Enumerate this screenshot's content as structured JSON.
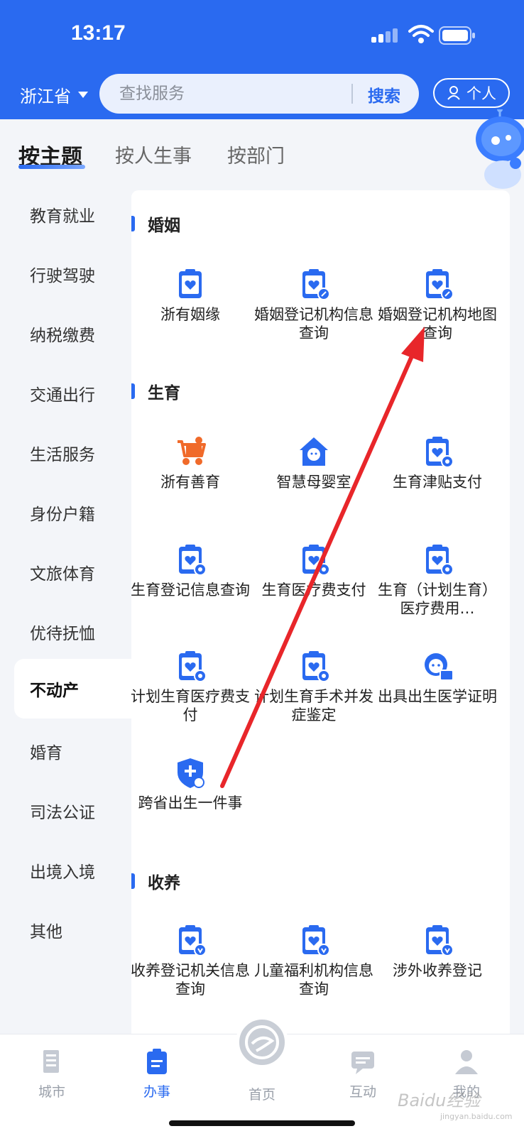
{
  "status": {
    "time": "13:17"
  },
  "header": {
    "province": "浙江省",
    "search_placeholder": "查找服务",
    "search_button": "搜索",
    "personal": "个人"
  },
  "tabs": [
    {
      "label": "按主题",
      "active": true
    },
    {
      "label": "按人生事",
      "active": false
    },
    {
      "label": "按部门",
      "active": false
    }
  ],
  "sidebar": {
    "items": [
      {
        "label": "教育就业"
      },
      {
        "label": "行驶驾驶"
      },
      {
        "label": "纳税缴费"
      },
      {
        "label": "交通出行"
      },
      {
        "label": "生活服务"
      },
      {
        "label": "身份户籍"
      },
      {
        "label": "文旅体育"
      },
      {
        "label": "优待抚恤"
      },
      {
        "label": "不动产",
        "active": true
      },
      {
        "label": "婚育"
      },
      {
        "label": "司法公证"
      },
      {
        "label": "出境入境"
      },
      {
        "label": "其他"
      }
    ]
  },
  "sections": [
    {
      "title": "婚姻",
      "services": [
        {
          "label": "浙有姻缘",
          "icon": "clipboard-heart-icon"
        },
        {
          "label": "婚姻登记机构信息查询",
          "icon": "clipboard-heart-edit-icon"
        },
        {
          "label": "婚姻登记机构地图查询",
          "icon": "clipboard-heart-edit-icon"
        }
      ]
    },
    {
      "title": "生育",
      "services": [
        {
          "label": "浙有善育",
          "icon": "stroller-icon"
        },
        {
          "label": "智慧母婴室",
          "icon": "house-baby-icon"
        },
        {
          "label": "生育津贴支付",
          "icon": "clipboard-baby-icon"
        },
        {
          "label": "生育登记信息查询",
          "icon": "clipboard-baby-icon"
        },
        {
          "label": "生育医疗费支付",
          "icon": "clipboard-baby-icon"
        },
        {
          "label": "生育（计划生育）医疗费用…",
          "icon": "clipboard-baby-icon"
        },
        {
          "label": "计划生育医疗费支付",
          "icon": "clipboard-baby-icon"
        },
        {
          "label": "计划生育手术并发症鉴定",
          "icon": "clipboard-baby-icon"
        },
        {
          "label": "出具出生医学证明",
          "icon": "baby-card-icon"
        },
        {
          "label": "跨省出生一件事",
          "icon": "shield-baby-icon"
        }
      ]
    },
    {
      "title": "收养",
      "services": [
        {
          "label": "收养登记机关信息查询",
          "icon": "clipboard-heart-location-icon"
        },
        {
          "label": "儿童福利机构信息查询",
          "icon": "clipboard-heart-location-icon"
        },
        {
          "label": "涉外收养登记",
          "icon": "clipboard-heart-location-icon"
        }
      ]
    }
  ],
  "bottom_nav": [
    {
      "label": "城市",
      "icon": "building-icon"
    },
    {
      "label": "办事",
      "icon": "clipboard-icon",
      "active": true
    },
    {
      "label": "首页",
      "icon": "home-logo-icon"
    },
    {
      "label": "互动",
      "icon": "chat-icon"
    },
    {
      "label": "我的",
      "icon": "user-icon"
    }
  ],
  "watermark": {
    "text": "Baidu经验",
    "sub": "jingyan.baidu.com"
  },
  "colors": {
    "brand": "#2a6af0",
    "arrow": "#e8262a",
    "orange": "#f06a2a"
  }
}
